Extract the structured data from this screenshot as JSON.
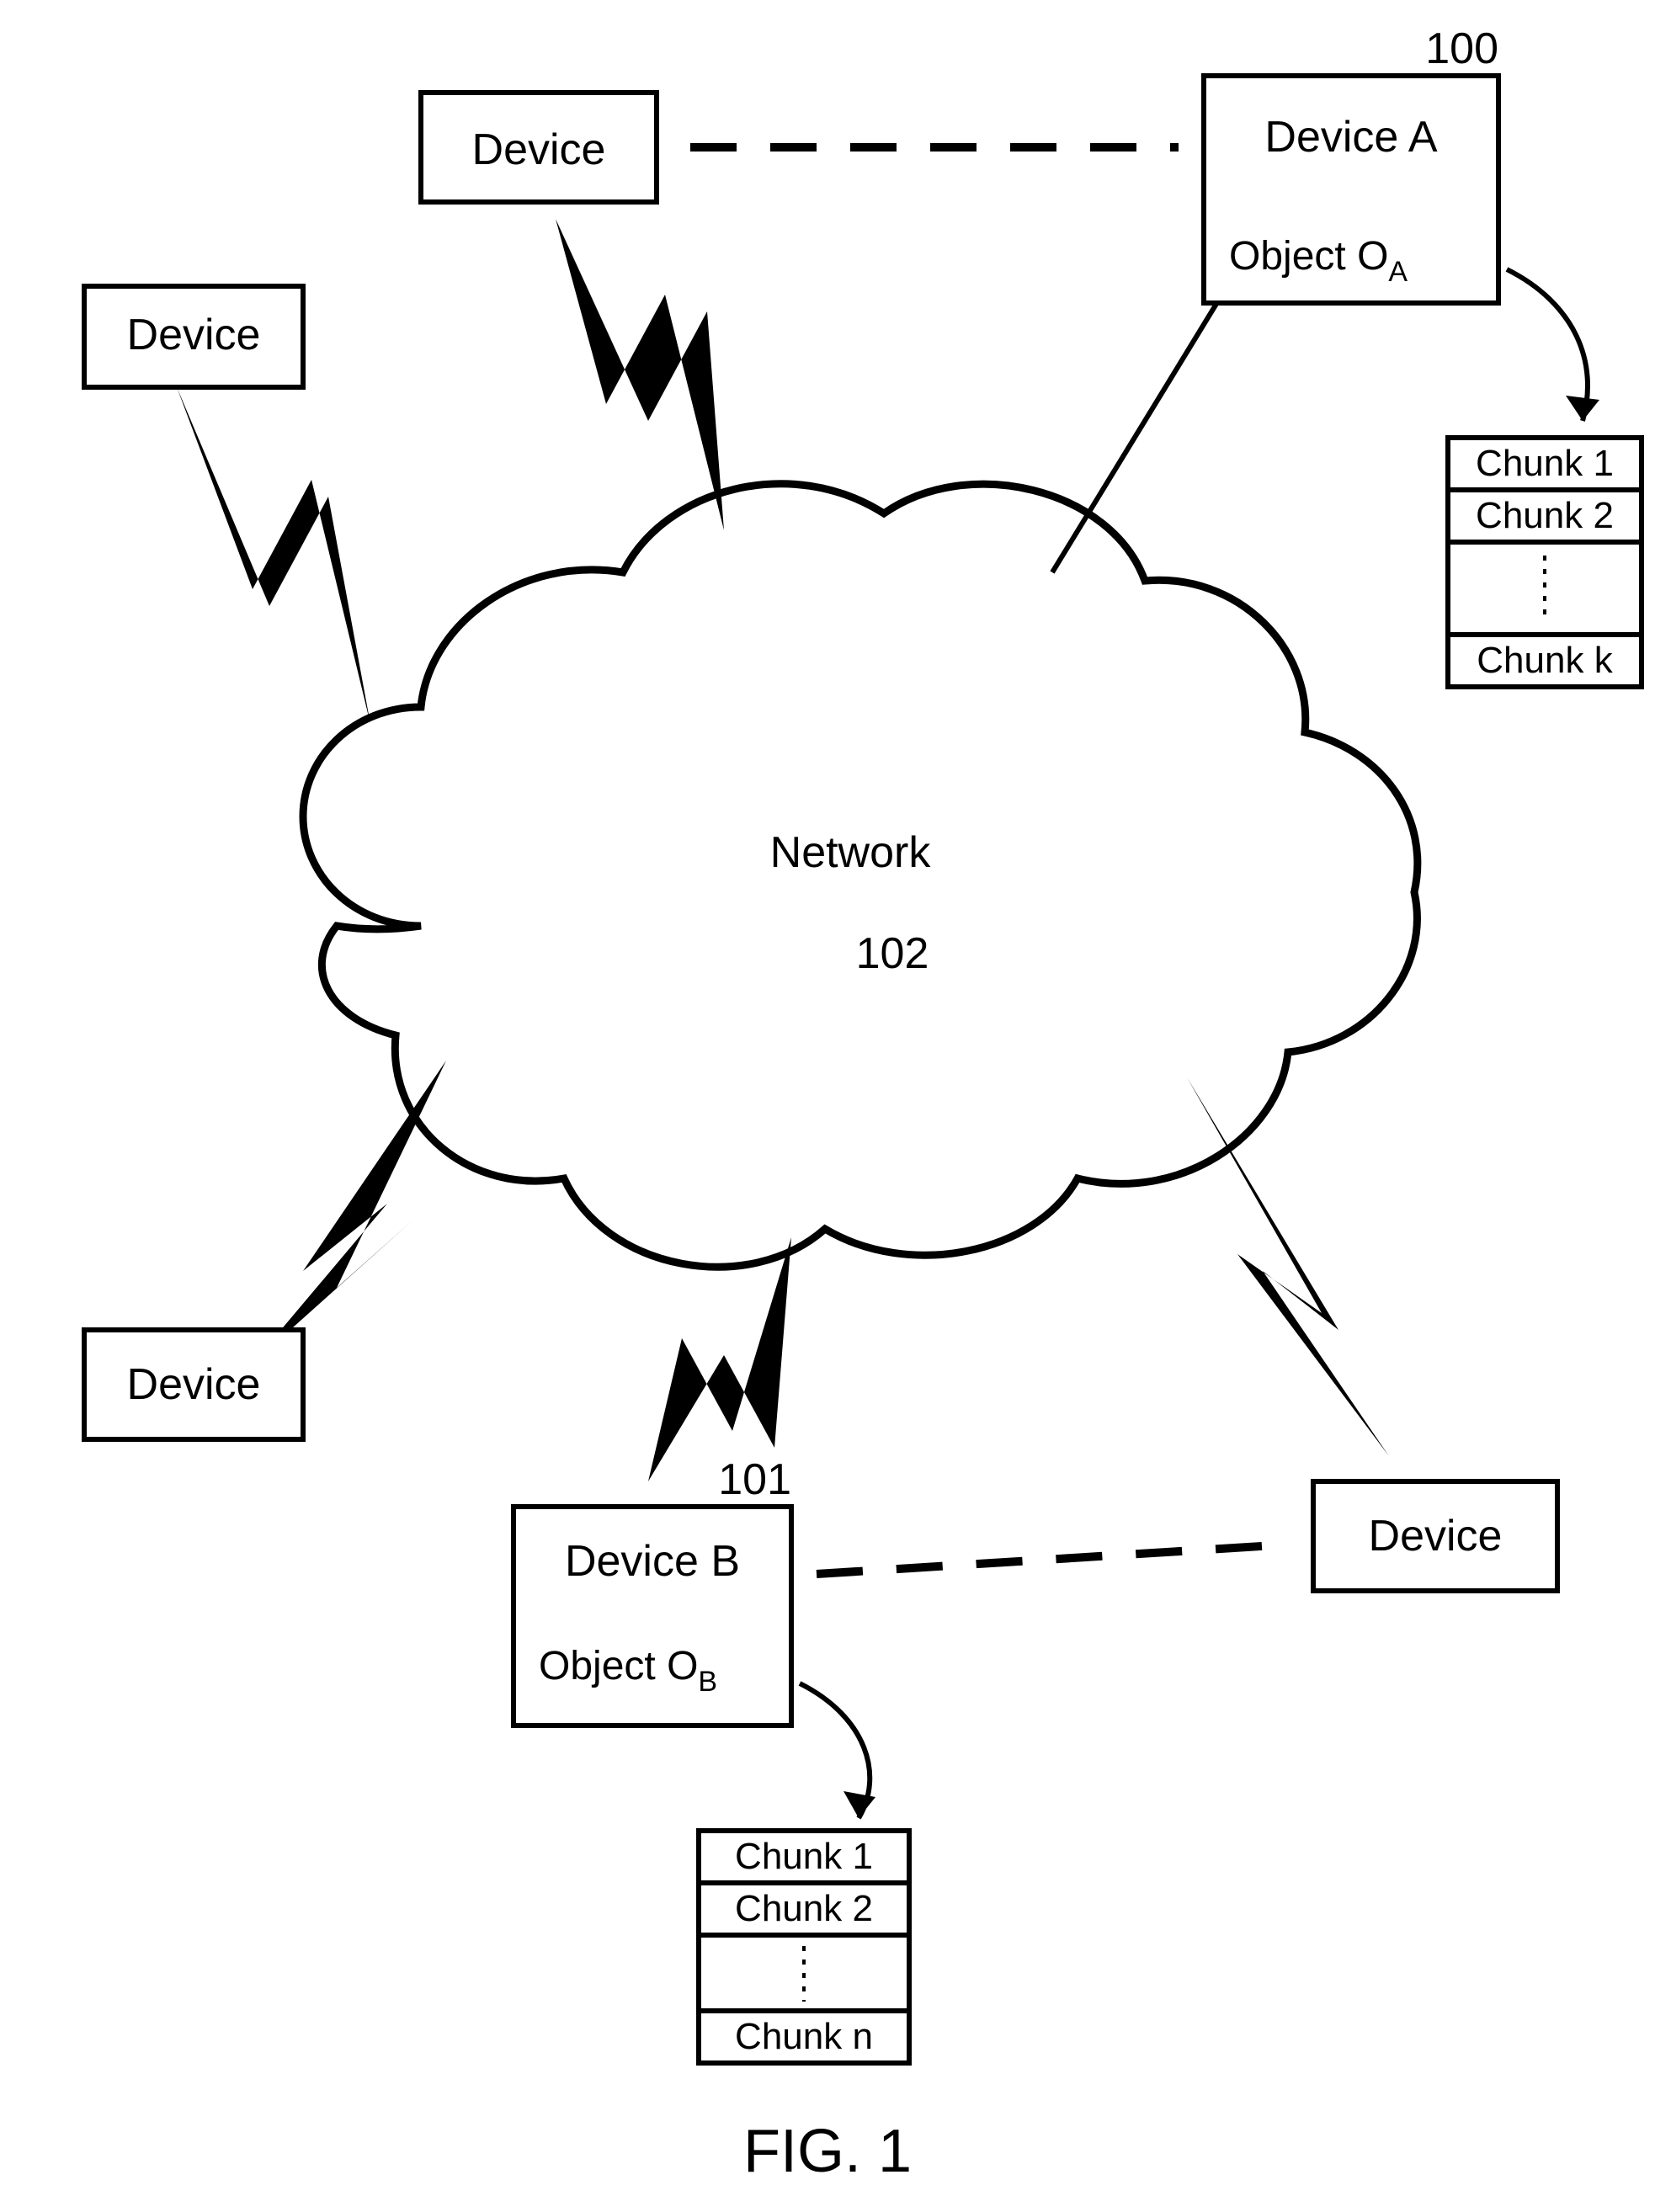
{
  "figure_label": "FIG. 1",
  "refs": {
    "deviceA": "100",
    "deviceB": "101",
    "network": "102"
  },
  "cloud": {
    "title": "Network"
  },
  "devices": {
    "generic": "Device",
    "A": {
      "title": "Device A",
      "object_prefix": "Object O",
      "object_sub": "A"
    },
    "B": {
      "title": "Device B",
      "object_prefix": "Object O",
      "object_sub": "B"
    }
  },
  "chunksA": {
    "c1": "Chunk 1",
    "c2": "Chunk 2",
    "ck": "Chunk k"
  },
  "chunksB": {
    "c1": "Chunk 1",
    "c2": "Chunk 2",
    "cn": "Chunk n"
  }
}
